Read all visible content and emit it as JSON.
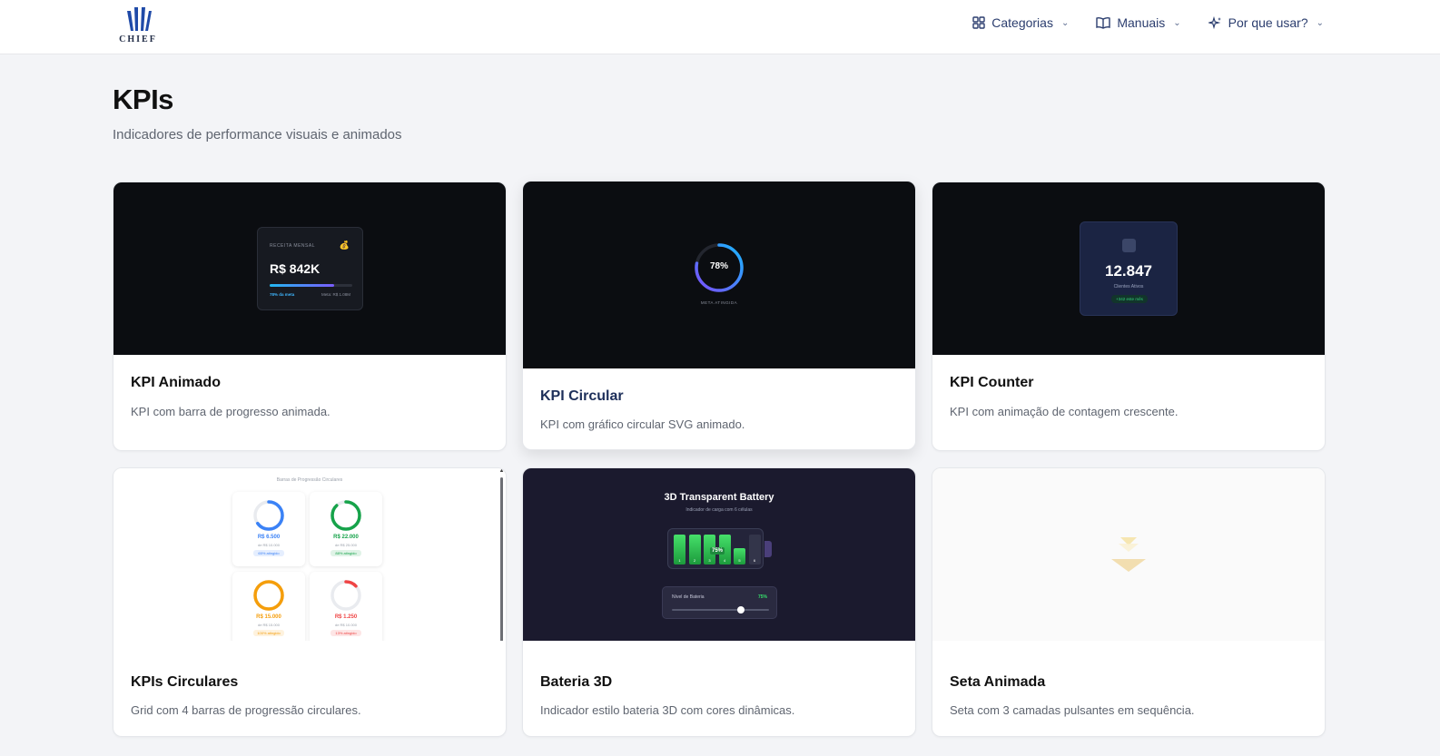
{
  "header": {
    "logo_text": "CHIEF",
    "nav": [
      {
        "label": "Categorias",
        "icon": "grid-icon"
      },
      {
        "label": "Manuais",
        "icon": "book-icon"
      },
      {
        "label": "Por que usar?",
        "icon": "sparkles-icon"
      }
    ]
  },
  "page": {
    "title": "KPIs",
    "subtitle": "Indicadores de performance visuais e animados"
  },
  "cards": [
    {
      "title": "KPI Animado",
      "description": "KPI com barra de progresso animada.",
      "preview": {
        "label": "RECEITA MENSAL",
        "value": "R$ 842K",
        "progress": 0.78,
        "progress_label": "78% da meta",
        "goal_label": "Meta: R$ 1.08M"
      }
    },
    {
      "title": "KPI Circular",
      "description": "KPI com gráfico circular SVG animado.",
      "preview": {
        "value": "78%",
        "progress": 0.78,
        "label": "META ATINGIDA"
      }
    },
    {
      "title": "KPI Counter",
      "description": "KPI com animação de contagem crescente.",
      "preview": {
        "value": "12.847",
        "label": "Clientes Ativos",
        "badge": "+342 este mês"
      }
    },
    {
      "title": "KPIs Circulares",
      "description": "Grid com 4 barras de progressão circulares.",
      "preview": {
        "heading": "Barras de Progressão Circulares",
        "items": [
          {
            "value": "R$ 6.500",
            "detail": "de R$ 10.000",
            "pct": "65% atingido",
            "progress": 0.65,
            "color": "#3b82f6"
          },
          {
            "value": "R$ 22.000",
            "detail": "de R$ 25.000",
            "pct": "88% atingido",
            "progress": 0.88,
            "color": "#16a34a"
          },
          {
            "value": "R$ 15.000",
            "detail": "de R$ 15.000",
            "pct": "100% atingido",
            "progress": 1.0,
            "color": "#f59e0b"
          },
          {
            "value": "R$ 1.250",
            "detail": "de R$ 10.000",
            "pct": "13% atingido",
            "progress": 0.13,
            "color": "#ef4444"
          }
        ]
      }
    },
    {
      "title": "Bateria 3D",
      "description": "Indicador estilo bateria 3D com cores dinâmicas.",
      "preview": {
        "heading": "3D Transparent Battery",
        "subheading": "Indicador de carga com 6 células",
        "cells": [
          "1",
          "2",
          "3",
          "4",
          "5",
          "6"
        ],
        "level": "75%",
        "level_value": 0.75,
        "slider_label": "Nível de Bateria"
      }
    },
    {
      "title": "Seta Animada",
      "description": "Seta com 3 camadas pulsantes em sequência."
    }
  ],
  "colors": {
    "accent": "#2b3d6e",
    "preview_dark": "#0b0d11",
    "battery_green": "#36e06b",
    "arrow": "#f2d48a"
  }
}
